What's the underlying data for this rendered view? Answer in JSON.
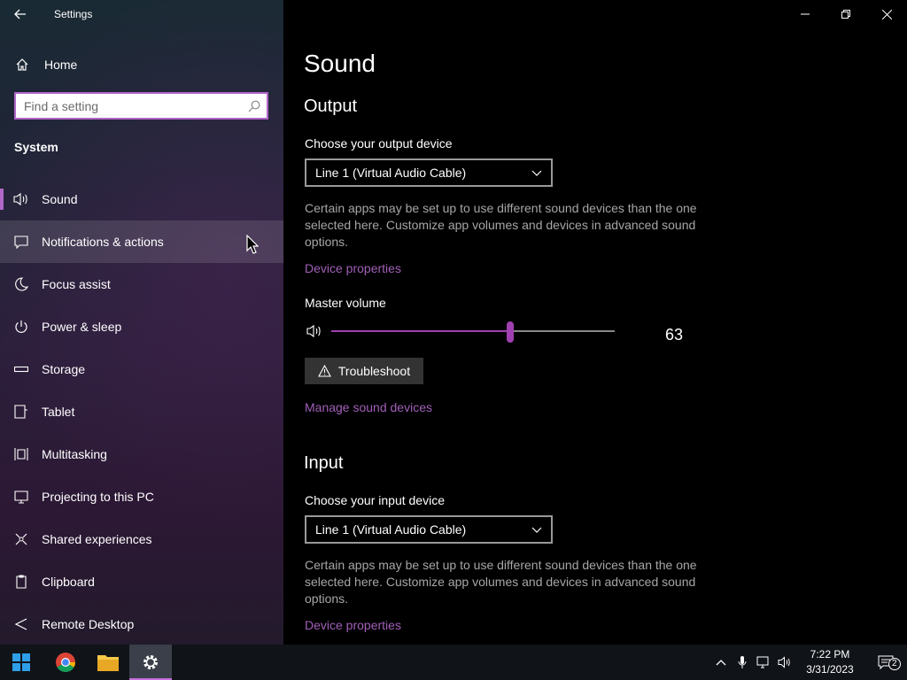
{
  "app_title": "Settings",
  "home_label": "Home",
  "search": {
    "placeholder": "Find a setting"
  },
  "group_label": "System",
  "nav": [
    {
      "label": "Sound",
      "icon": "speaker-icon"
    },
    {
      "label": "Notifications & actions",
      "icon": "notification-icon"
    },
    {
      "label": "Focus assist",
      "icon": "moon-icon"
    },
    {
      "label": "Power & sleep",
      "icon": "power-icon"
    },
    {
      "label": "Storage",
      "icon": "storage-icon"
    },
    {
      "label": "Tablet",
      "icon": "tablet-icon"
    },
    {
      "label": "Multitasking",
      "icon": "multitasking-icon"
    },
    {
      "label": "Projecting to this PC",
      "icon": "projecting-icon"
    },
    {
      "label": "Shared experiences",
      "icon": "shared-icon"
    },
    {
      "label": "Clipboard",
      "icon": "clipboard-icon"
    },
    {
      "label": "Remote Desktop",
      "icon": "remote-desktop-icon"
    }
  ],
  "page_title": "Sound",
  "output": {
    "heading": "Output",
    "choose_label": "Choose your output device",
    "device": "Line 1 (Virtual Audio Cable)",
    "description": "Certain apps may be set up to use different sound devices than the one selected here. Customize app volumes and devices in advanced sound options.",
    "device_properties": "Device properties",
    "master_volume_label": "Master volume",
    "volume": 63,
    "volume_text": "63",
    "troubleshoot": "Troubleshoot",
    "manage_devices": "Manage sound devices"
  },
  "input": {
    "heading": "Input",
    "choose_label": "Choose your input device",
    "device": "Line 1 (Virtual Audio Cable)",
    "description": "Certain apps may be set up to use different sound devices than the one selected here. Customize app volumes and devices in advanced sound options.",
    "device_properties": "Device properties"
  },
  "taskbar": {
    "time": "7:22 PM",
    "date": "3/31/2023",
    "notification_count": "2"
  },
  "colors": {
    "accent": "#a040b0",
    "link": "#a15fb8"
  }
}
